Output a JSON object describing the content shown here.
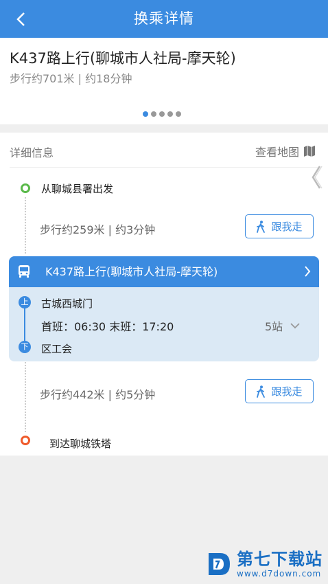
{
  "header": {
    "title": "换乘详情",
    "back_icon": "chevron-left-icon"
  },
  "route": {
    "title": "K437路上行(聊城市人社局-摩天轮)",
    "summary": "步行约701米 | 约18分钟",
    "pager": {
      "count": 5,
      "active": 0
    }
  },
  "detail": {
    "label": "详细信息",
    "map_link": "查看地图",
    "start": "从聊城县署出发",
    "walk1": {
      "text": "步行约259米 | 约3分钟",
      "button": "跟我走"
    },
    "bus": {
      "name": "K437路上行(聊城市人社局-摩天轮)",
      "board_badge": "上",
      "board_stop": "古城西城门",
      "schedule": "首班：06:30 末班：17:20",
      "stations": "5站",
      "alight_badge": "下",
      "alight_stop": "区工会"
    },
    "walk2": {
      "text": "步行约442米 | 约5分钟",
      "button": "跟我走"
    },
    "end": "到达聊城铁塔"
  },
  "watermark": {
    "name": "第七下载站",
    "url": "www.d7down.com"
  },
  "colors": {
    "primary": "#3b8be0",
    "start": "#5ab94a",
    "end": "#ef5a2a",
    "bus_bg": "#dbe9f5"
  }
}
